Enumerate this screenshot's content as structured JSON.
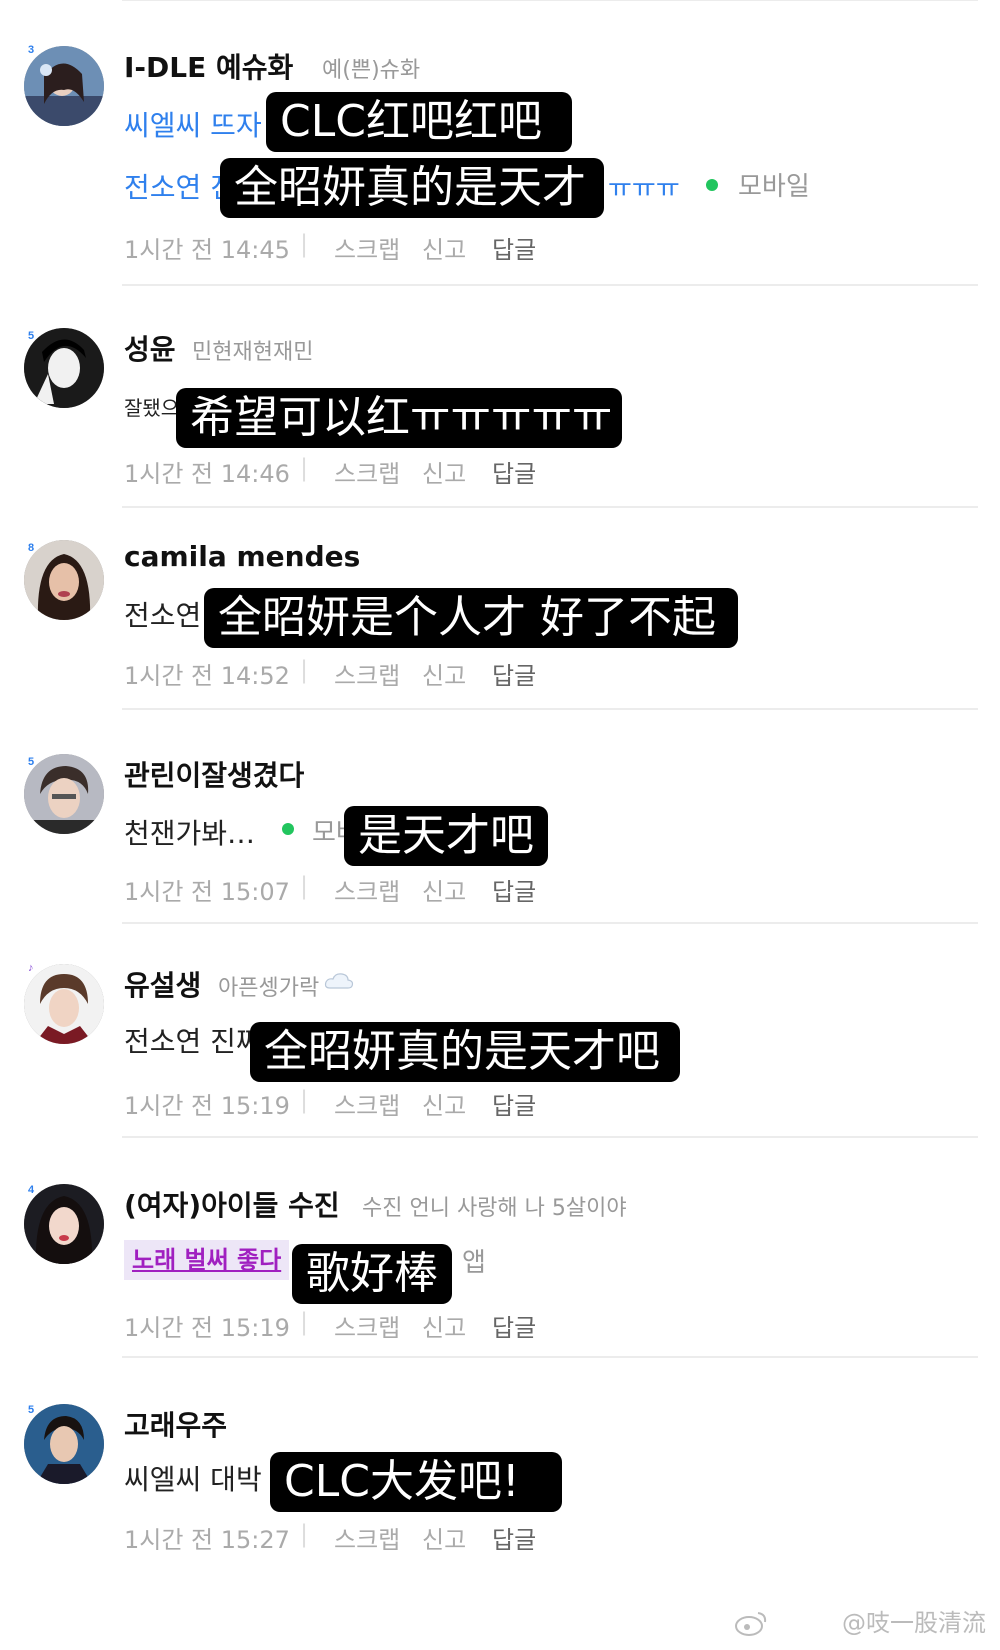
{
  "comments": [
    {
      "level": "3",
      "author": "I-DLE 예슈화",
      "nickname": "예(쁜)슈화",
      "text_line1": "씨엘씨 뜨자",
      "text_line2": "전소연 진",
      "tail": "ㅠㅠㅠ",
      "device": "모바일",
      "time": "1시간 전  14:45",
      "overlays": [
        "CLC红吧红吧",
        "全昭妍真的是天才"
      ]
    },
    {
      "level": "5",
      "author": "성윤",
      "nickname": "민현재현재민",
      "text": "잘됐으",
      "time": "1시간 전  14:46",
      "overlay": "希望可以红ㅠㅠㅠㅠㅠ"
    },
    {
      "level": "8",
      "author": "camila mendes",
      "text": "전소연",
      "time": "1시간 전  14:52",
      "overlay": "全昭妍是个人才 好了不起"
    },
    {
      "level": "5",
      "author": "관린이잘생겼다",
      "text": "천잰가봐…",
      "device": "모바",
      "time": "1시간 전  15:07",
      "overlay": "是天才吧"
    },
    {
      "level": "♪",
      "author": "유설생",
      "nickname": "아픈셍가락",
      "text": "전소연 진짜",
      "time": "1시간 전  15:19",
      "overlay": "全昭妍真的是天才吧"
    },
    {
      "level": "4",
      "author": "(여자)아이들 수진",
      "nickname": "수진 언니 사랑해 나 5살이야",
      "sticker": "노래 벌써 좋다",
      "device": "앱",
      "time": "1시간 전  15:19",
      "overlay": "歌好棒"
    },
    {
      "level": "5",
      "author": "고래우주",
      "text": "씨엘씨 대박",
      "time": "1시간 전  15:27",
      "overlay": "CLC大发吧!"
    }
  ],
  "actions": {
    "scrap": "스크랩",
    "report": "신고",
    "reply": "답글",
    "pipe": "|"
  },
  "watermark": "@吱一股清流",
  "colors": {
    "link": "#2f80ed",
    "online_dot": "#22c55e",
    "sticker": "#a020c0",
    "overlay_bg": "#000000"
  }
}
